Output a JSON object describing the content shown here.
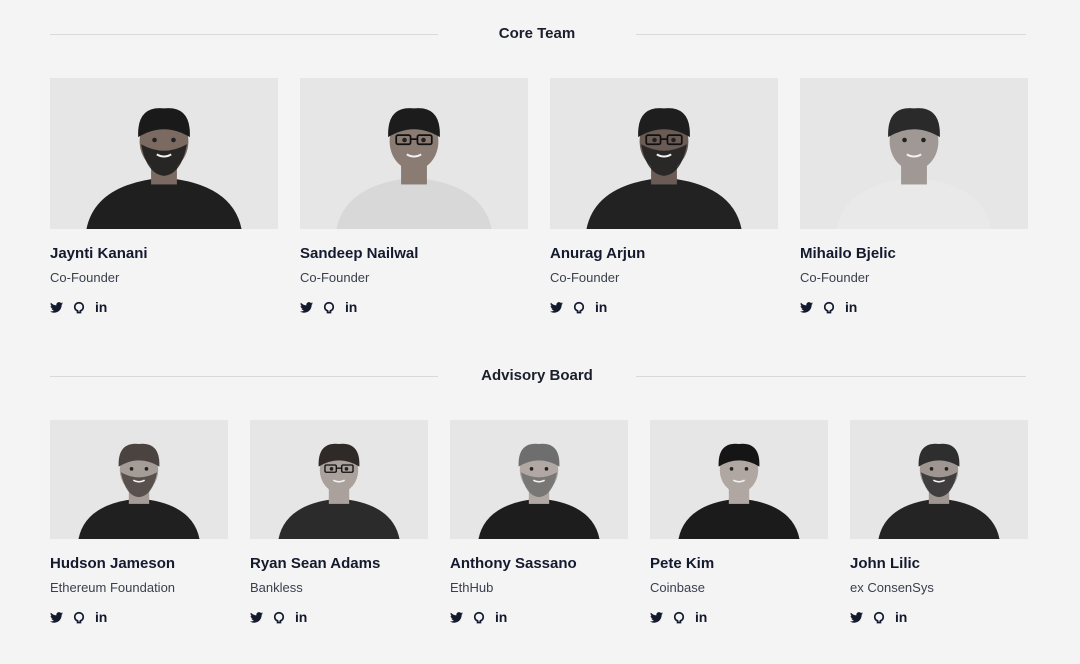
{
  "core": {
    "title": "Core Team",
    "members": [
      {
        "name": "Jaynti Kanani",
        "role": "Co-Founder",
        "shirt": "#1f1f1f",
        "hair": "#1a1a1a",
        "skin": "#7a6a62",
        "glasses": false,
        "beard": true
      },
      {
        "name": "Sandeep Nailwal",
        "role": "Co-Founder",
        "shirt": "#d8d8d8",
        "hair": "#1c1c1c",
        "skin": "#8a7b73",
        "glasses": true,
        "beard": false
      },
      {
        "name": "Anurag Arjun",
        "role": "Co-Founder",
        "shirt": "#222222",
        "hair": "#1e1e1e",
        "skin": "#6a5c55",
        "glasses": true,
        "beard": true
      },
      {
        "name": "Mihailo Bjelic",
        "role": "Co-Founder",
        "shirt": "#e9e9e9",
        "hair": "#2a2a2a",
        "skin": "#a09894",
        "glasses": false,
        "beard": false
      }
    ]
  },
  "advisory": {
    "title": "Advisory Board",
    "members": [
      {
        "name": "Hudson Jameson",
        "role": "Ethereum Foundation",
        "shirt": "#202020",
        "hair": "#4a4340",
        "skin": "#a59c97",
        "glasses": false,
        "beard": true
      },
      {
        "name": "Ryan Sean Adams",
        "role": "Bankless",
        "shirt": "#2b2b2b",
        "hair": "#2f2a28",
        "skin": "#aaa19c",
        "glasses": true,
        "beard": false
      },
      {
        "name": "Anthony Sassano",
        "role": "EthHub",
        "shirt": "#1d1d1d",
        "hair": "#6e6e6e",
        "skin": "#b1a8a3",
        "glasses": false,
        "beard": true
      },
      {
        "name": "Pete Kim",
        "role": "Coinbase",
        "shirt": "#1b1b1b",
        "hair": "#151515",
        "skin": "#b0a7a2",
        "glasses": false,
        "beard": false
      },
      {
        "name": "John Lilic",
        "role": "ex ConsenSys",
        "shirt": "#242424",
        "hair": "#2e2e2e",
        "skin": "#9f9691",
        "glasses": false,
        "beard": true
      }
    ]
  },
  "icons": {
    "twitter": "twitter-icon",
    "github": "github-icon",
    "linkedin": "linkedin-icon",
    "linkedin_text": "in"
  },
  "colors": {
    "background": "#f4f4f4",
    "photo_bg": "#e6e6e6",
    "text": "#141a2e",
    "rule": "#d9d9d9"
  }
}
